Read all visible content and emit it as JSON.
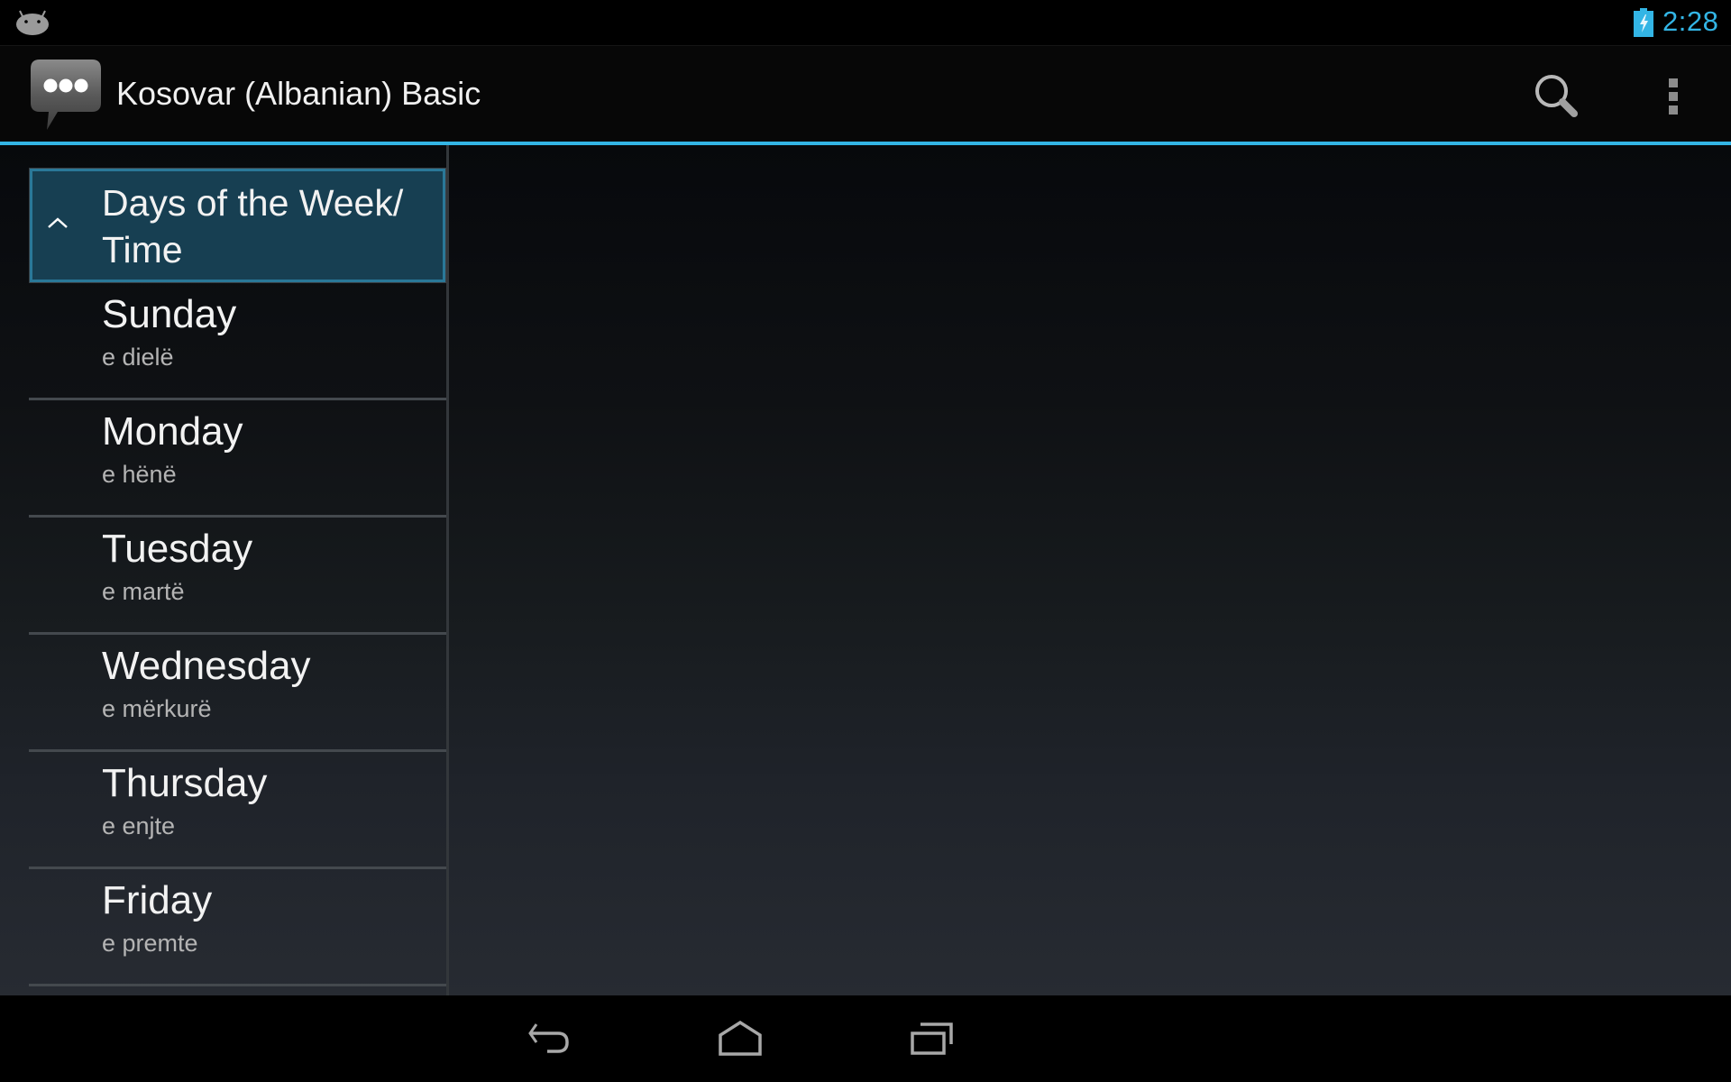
{
  "status_bar": {
    "left_icon": "android-debug-icon",
    "battery_icon": "battery-charging-icon",
    "time": "2:28",
    "accent_color": "#33b5e5"
  },
  "action_bar": {
    "app_icon": "chat-bubble-icon",
    "title": "Kosovar (Albanian) Basic",
    "actions": [
      {
        "name": "search",
        "icon": "search-icon"
      },
      {
        "name": "more-options",
        "icon": "overflow-menu-icon"
      }
    ]
  },
  "list": {
    "group": {
      "title": "Days of the Week/ Time",
      "expanded": true,
      "chevron_icon": "chevron-up-icon"
    },
    "items": [
      {
        "title": "Sunday",
        "subtitle": "e dielë"
      },
      {
        "title": "Monday",
        "subtitle": "e hënë"
      },
      {
        "title": "Tuesday",
        "subtitle": "e martë"
      },
      {
        "title": "Wednesday",
        "subtitle": "e mërkurë"
      },
      {
        "title": "Thursday",
        "subtitle": "e enjte"
      },
      {
        "title": "Friday",
        "subtitle": "e premte"
      }
    ]
  },
  "nav_bar": {
    "buttons": [
      {
        "name": "back",
        "icon": "back-icon"
      },
      {
        "name": "home",
        "icon": "home-icon"
      },
      {
        "name": "recents",
        "icon": "recent-apps-icon"
      }
    ]
  }
}
